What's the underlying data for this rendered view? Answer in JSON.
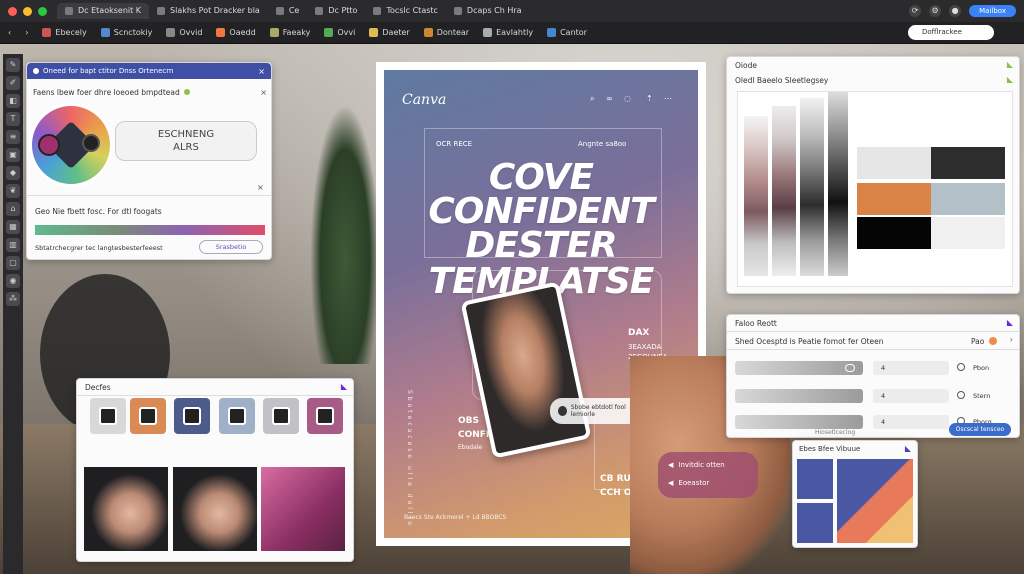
{
  "browser": {
    "tabs": [
      {
        "label": "Dc Etaoksenit K"
      },
      {
        "label": "Slakhs Pot Dracker bla"
      },
      {
        "label": "Ce"
      },
      {
        "label": "Dc Ptto"
      },
      {
        "label": "Tocslc Ctastc"
      },
      {
        "label": "Dcaps Ch Hra"
      }
    ],
    "profile_label": "Mailbox"
  },
  "bookmarks": {
    "items": [
      {
        "label": "Ebecely"
      },
      {
        "label": "Scnctokiy"
      },
      {
        "label": "Ovvid"
      },
      {
        "label": "Oaedd"
      },
      {
        "label": "Faeaky"
      },
      {
        "label": "Ovvi"
      },
      {
        "label": "Daeter"
      },
      {
        "label": "Dontear"
      },
      {
        "label": "Eavlahtly"
      },
      {
        "label": "Cantor"
      }
    ],
    "search_value": "Dofflrackee"
  },
  "left_panel": {
    "header": "Oneed for bapt ctitor Dnss Ortenecrn",
    "banner": "Faens lbew foer dhre loeoed bmpdtead",
    "badge_pill": "ESCHNENG ALRS",
    "section_label": "Geo Nie fbett fosc. For dtl foogats",
    "footer_text": "Sbtatrchecgrer tec langtesbesterfeeest",
    "footer_button": "Srasbetio"
  },
  "assets_panel": {
    "title": "Decfes"
  },
  "poster": {
    "brand": "Canva",
    "headline_lines": [
      "COVE",
      "CONFIDENT",
      "DESTER",
      "TEMPLATSE"
    ],
    "tag_left": "OCR RECE",
    "tag_right": "Angnte sa8oo",
    "side_a": "DAX",
    "side_b": "3EAXADA\n2EGOHNEA",
    "bottom_left_1": "OBS",
    "bottom_left_2": "CONFIENT",
    "bottom_left_3": "Ebodale",
    "bottom_right_1": "CB RUSO",
    "bottom_right_2": "CCH OKEO",
    "footer_small": "Baecs Ste Ackmerel + Ld BBOBCS",
    "chip_text": "Sbobe ebtdotl fool lemiorle",
    "vertical_text": "Sbotecacese ulle dollio"
  },
  "floating_chip": {
    "label1": "Invitdic otten",
    "label2": "Eoeastor"
  },
  "color_panel": {
    "title": "Oiode",
    "subtitle": "Oledl Baeelo Sleetlegsey",
    "swatches": [
      "#e6e6e6",
      "#2d2d2d",
      "#d98347",
      "#b4c0c8",
      "#050505",
      "#f0f0f0"
    ]
  },
  "props_panel": {
    "title": "Faloo Reott",
    "row_header": "Shed Ocesptd is Peatie fomot fer Oteen",
    "row_header_right": "Pao",
    "rows": [
      {
        "value": "4",
        "label": "Pbon"
      },
      {
        "value": "4",
        "label": "Stern"
      },
      {
        "value": "4",
        "label": "Pborg"
      }
    ],
    "footer_text": "Hiosetlceclog",
    "footer_button": "Oscscal tensceo"
  },
  "shapes_panel": {
    "title": "Ebes Bfee Vibuue"
  },
  "colors": {
    "accent_blue": "#3b82f6",
    "purple": "#6d28d9",
    "gradient_teal": "#5fb98f",
    "gradient_red": "#e04e68"
  }
}
